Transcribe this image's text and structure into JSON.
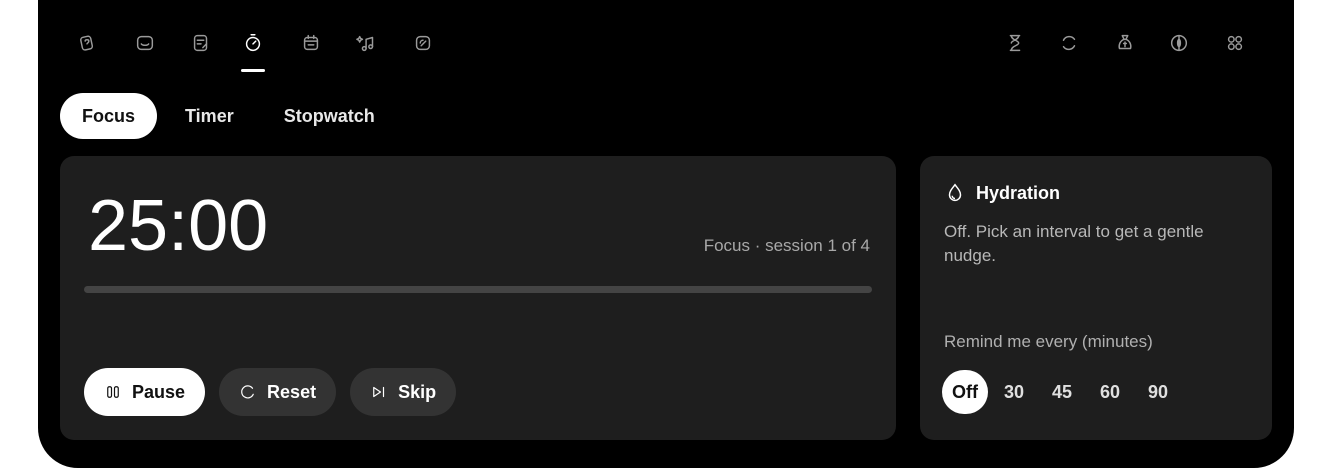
{
  "nav": {
    "left_icons": [
      {
        "name": "cards-icon"
      },
      {
        "name": "inbox-icon"
      },
      {
        "name": "notes-icon"
      },
      {
        "name": "focus-icon",
        "active": true
      },
      {
        "name": "calendar-icon"
      },
      {
        "name": "music-icon"
      },
      {
        "name": "gauge-icon"
      }
    ],
    "right_icons": [
      {
        "name": "hourglass-icon"
      },
      {
        "name": "refresh-icon"
      },
      {
        "name": "money-bag-icon"
      },
      {
        "name": "contrast-icon"
      },
      {
        "name": "grid-icon"
      }
    ]
  },
  "tabs": [
    {
      "label": "Focus",
      "selected": true
    },
    {
      "label": "Timer",
      "selected": false
    },
    {
      "label": "Stopwatch",
      "selected": false
    }
  ],
  "focus": {
    "time": "25:00",
    "session_label": "Focus · session 1 of 4",
    "progress": 0,
    "controls": {
      "pause": "Pause",
      "reset": "Reset",
      "skip": "Skip"
    }
  },
  "hydration": {
    "title": "Hydration",
    "description": "Off. Pick an interval to get a gentle nudge.",
    "remind_label": "Remind me every (minutes)",
    "intervals": [
      "Off",
      "30",
      "45",
      "60",
      "90"
    ],
    "selected_interval": "Off"
  },
  "colors": {
    "background": "#000000",
    "card": "#1e1e1e",
    "accent": "#ffffff",
    "muted_text": "#a8a8a8"
  }
}
